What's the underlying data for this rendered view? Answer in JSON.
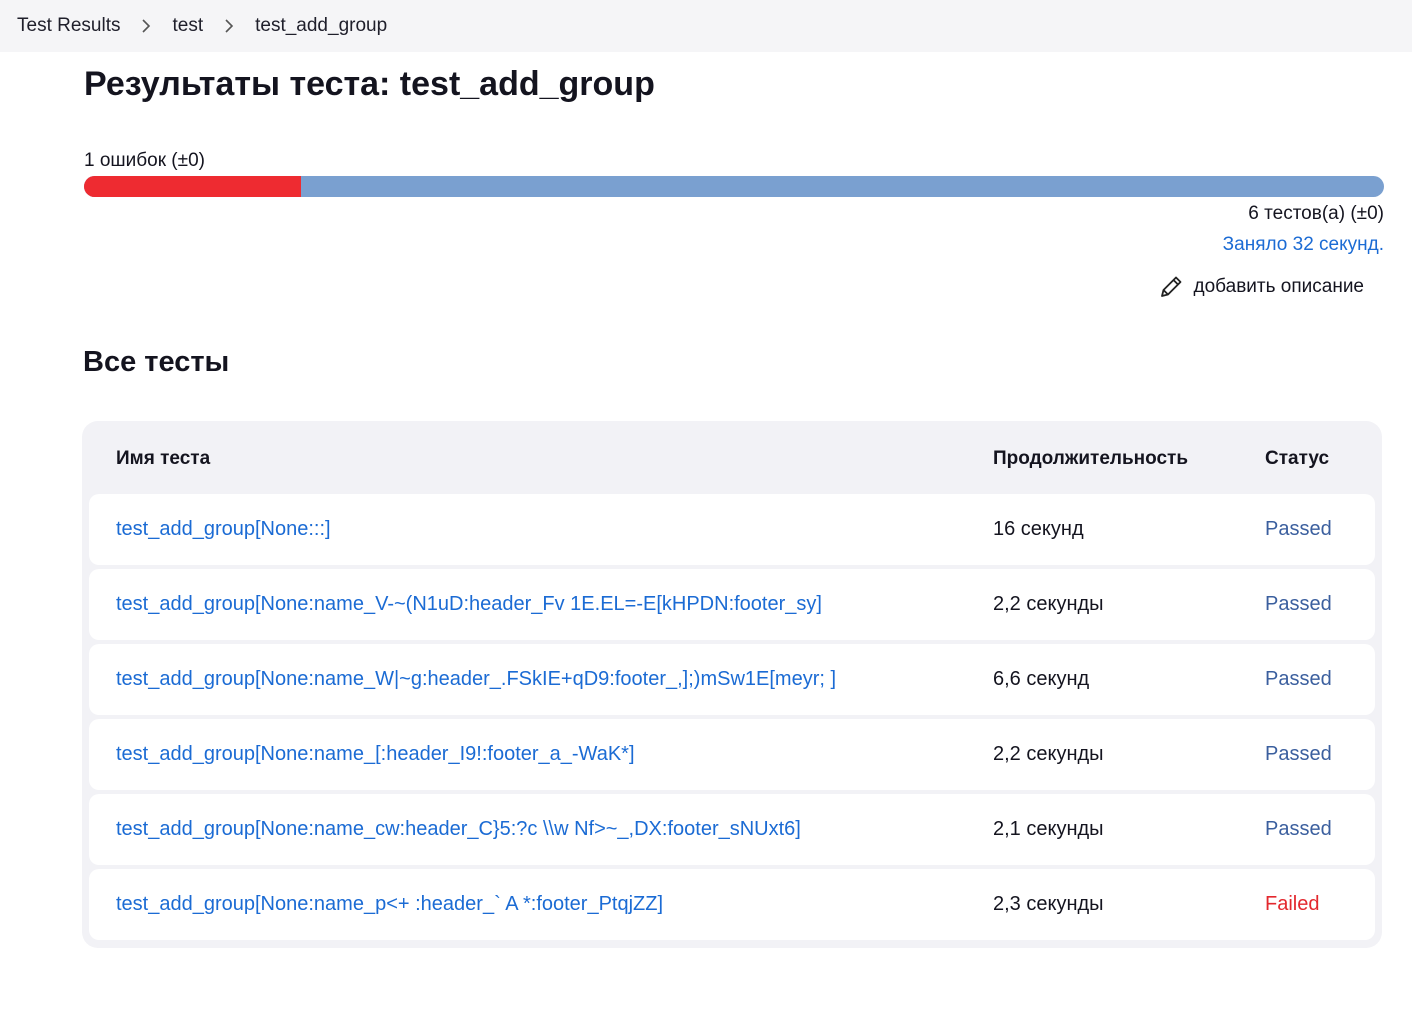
{
  "breadcrumb": [
    "Test Results",
    "test",
    "test_add_group"
  ],
  "title": "Результаты теста: test_add_group",
  "summary": {
    "failures_text": "1 ошибок (±0)",
    "total_text": "6 тестов(а) (±0)",
    "duration_text": "Заняло 32 секунд.",
    "add_description": "добавить описание",
    "fail_fraction": 0.1667,
    "colors": {
      "fail": "#ee2b31",
      "pass": "#7aa0d0"
    }
  },
  "section_title": "Все тесты",
  "table": {
    "headers": {
      "name": "Имя теста",
      "duration": "Продолжительность",
      "status": "Статус"
    },
    "rows": [
      {
        "name": "test_add_group[None:::]",
        "duration": "16 секунд",
        "status": "Passed"
      },
      {
        "name": "test_add_group[None:name_V-~(N1uD:header_Fv 1E.EL=-E[kHPDN:footer_sy]",
        "duration": "2,2 секунды",
        "status": "Passed"
      },
      {
        "name": "test_add_group[None:name_W|~g:header_.FSkIE+qD9:footer_,];)mSw1E[meyr; ]",
        "duration": "6,6 секунд",
        "status": "Passed"
      },
      {
        "name": "test_add_group[None:name_[:header_I9!:footer_a_-WaK*]",
        "duration": "2,2 секунды",
        "status": "Passed"
      },
      {
        "name": "test_add_group[None:name_cw:header_C}5:?c \\\\w Nf>~_,DX:footer_sNUxt6]",
        "duration": "2,1 секунды",
        "status": "Passed"
      },
      {
        "name": "test_add_group[None:name_p<+ :header_` A *:footer_PtqjZZ]",
        "duration": "2,3 секунды",
        "status": "Failed"
      }
    ]
  }
}
